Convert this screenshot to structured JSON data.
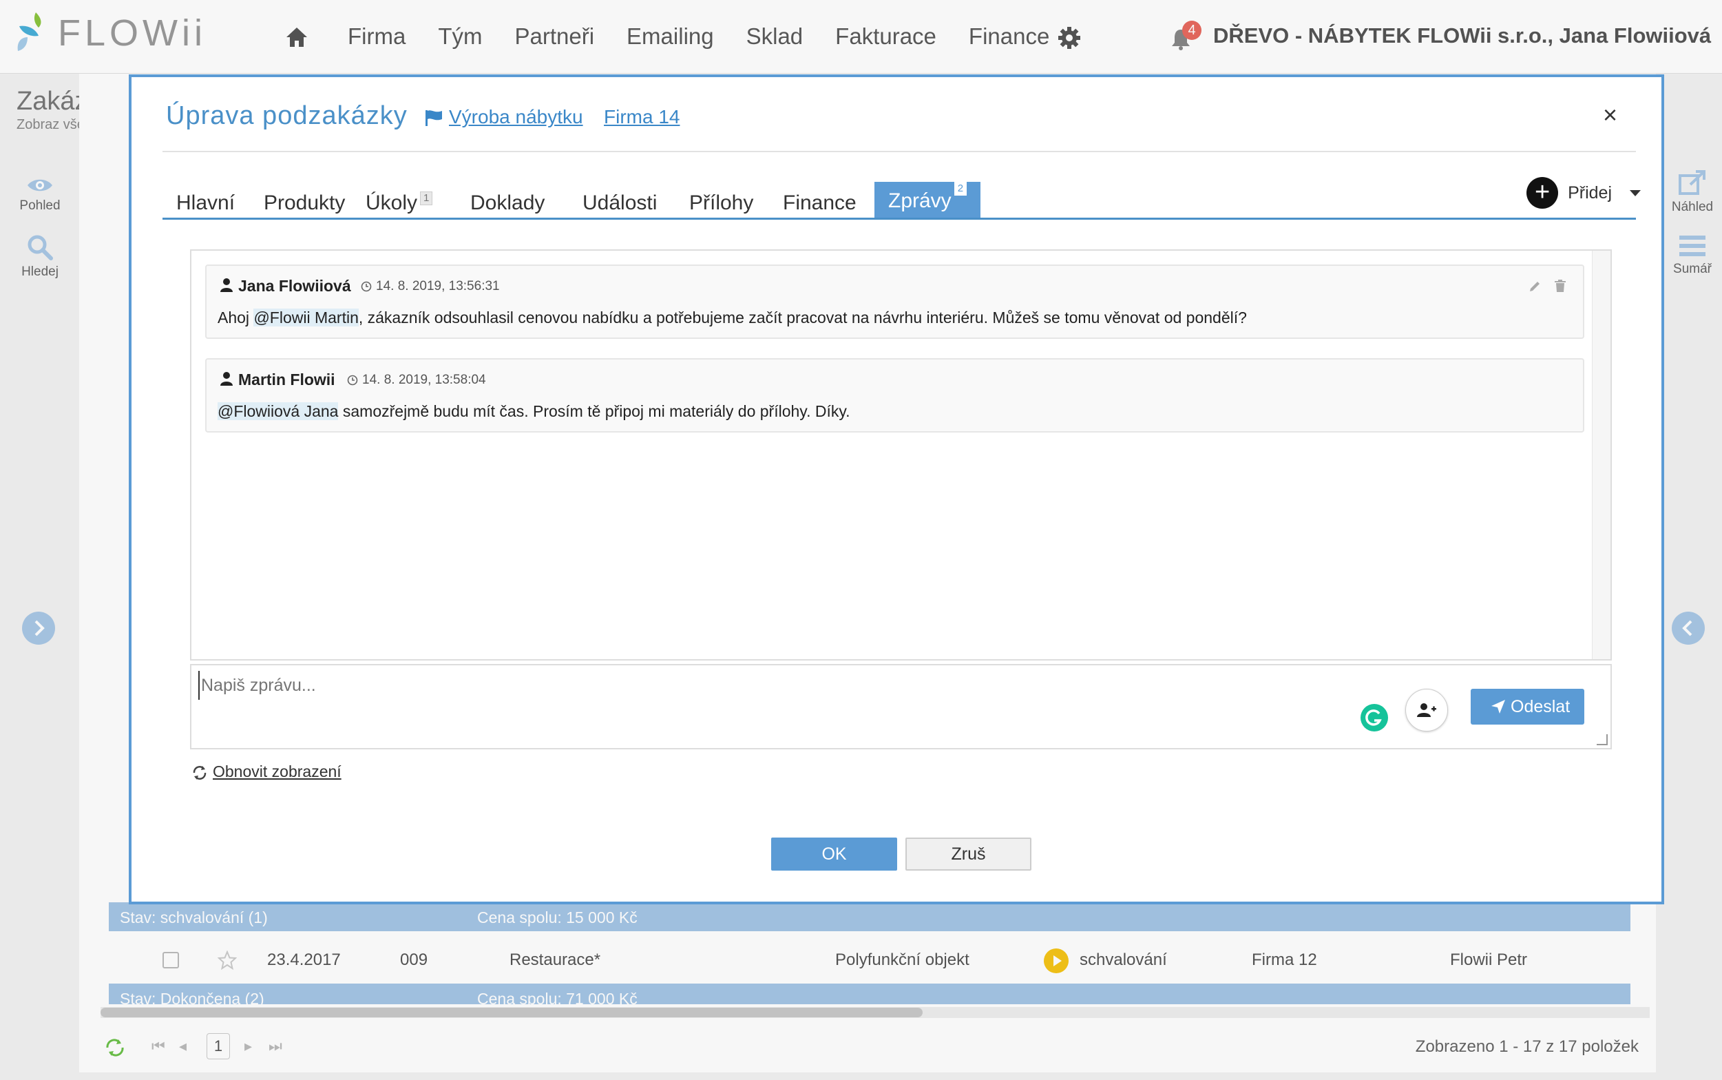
{
  "app": {
    "logo_text": "FLOWii",
    "company_user": "DŘEVO - NÁBYTEK FLOWii s.r.o., Jana Flowiiová",
    "notification_count": "4"
  },
  "nav": {
    "items": [
      "Firma",
      "Tým",
      "Partneři",
      "Emailing",
      "Sklad",
      "Fakturace",
      "Finance"
    ]
  },
  "page": {
    "title": "Zakázky",
    "subtitle": "Zobraz vše",
    "left_rail": {
      "view_label": "Pohled",
      "search_label": "Hledej"
    },
    "right_rail": {
      "preview_label": "Náhled",
      "summary_label": "Sumář"
    },
    "group_bars": [
      {
        "status": "Stav: schvalování (1)",
        "total": "Cena spolu: 15 000 Kč"
      },
      {
        "status": "Stav: Dokončena (2)",
        "total": "Cena spolu: 71 000 Kč"
      }
    ],
    "row": {
      "date": "23.4.2017",
      "number": "009",
      "name": "Restaurace*",
      "type": "Polyfunkční objekt",
      "state": "schvalování",
      "company": "Firma 12",
      "owner": "Flowii Petr"
    },
    "pager": {
      "page": "1",
      "status": "Zobrazeno 1 - 17 z 17 položek"
    }
  },
  "modal": {
    "title": "Úprava podzakázky",
    "link_project": "Výroba nábytku",
    "link_company": "Firma 14",
    "close_label": "×",
    "tabs": [
      {
        "label": "Hlavní",
        "count": ""
      },
      {
        "label": "Produkty",
        "count": ""
      },
      {
        "label": "Úkoly",
        "count": "1"
      },
      {
        "label": "Doklady",
        "count": ""
      },
      {
        "label": "Události",
        "count": ""
      },
      {
        "label": "Přílohy",
        "count": ""
      },
      {
        "label": "Finance",
        "count": ""
      },
      {
        "label": "Zprávy",
        "count": "2"
      }
    ],
    "active_tab": "Zprávy",
    "add_label": "Přidej",
    "messages": [
      {
        "author": "Jana Flowiiová",
        "time": "14. 8. 2019, 13:56:31",
        "prefix": "Ahoj ",
        "mention": "@Flowii Martin",
        "text": ", zákazník odsouhlasil cenovou nabídku a potřebujeme začít pracovat na návrhu interiéru. Můžeš se tomu věnovat od pondělí?"
      },
      {
        "author": "Martin Flowii",
        "time": "14. 8. 2019, 13:58:04",
        "prefix": "",
        "mention": "@Flowiiová Jana",
        "text": " samozřejmě budu mít čas. Prosím tě připoj mi materiály do přílohy. Díky."
      }
    ],
    "compose_placeholder": "Napiš zprávu...",
    "send_label": "Odeslat",
    "refresh_label": "Obnovit zobrazení",
    "ok_label": "OK",
    "cancel_label": "Zruš"
  },
  "colors": {
    "accent": "#5b9bd5",
    "link": "#3a87c8",
    "badge": "#e86a5f",
    "group_bar": "#a5c6e6"
  }
}
